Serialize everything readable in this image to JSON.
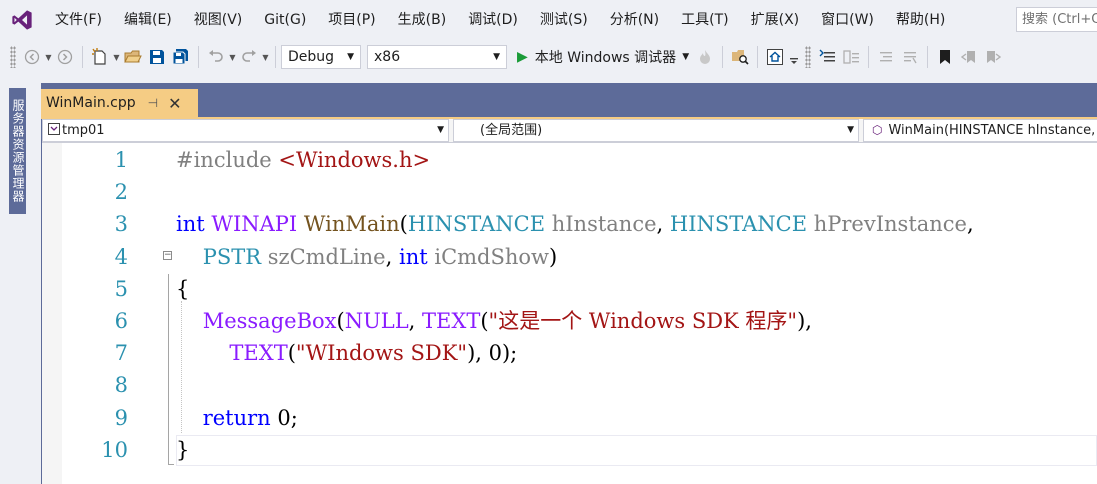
{
  "menu": {
    "items": [
      "文件(F)",
      "编辑(E)",
      "视图(V)",
      "Git(G)",
      "项目(P)",
      "生成(B)",
      "调试(D)",
      "测试(S)",
      "分析(N)",
      "工具(T)",
      "扩展(X)",
      "窗口(W)",
      "帮助(H)"
    ],
    "search_placeholder": "搜索 (Ctrl+Q)"
  },
  "toolbar": {
    "configuration": "Debug",
    "platform": "x86",
    "run_label": "本地 Windows 调试器"
  },
  "side_panel": {
    "label": "服务器资源管理器"
  },
  "document_tab": {
    "title": "WinMain.cpp",
    "pin_icon": "pin-icon",
    "close_icon": "close-icon"
  },
  "nav_bar": {
    "project": "tmp01",
    "scope": "(全局范围)",
    "member": "WinMain(HINSTANCE hInstance, HINSTANCE hPrevInstance, PSTR szCmdLine, int iCmdShow)"
  },
  "editor": {
    "line_numbers": [
      "1",
      "2",
      "3",
      "4",
      "5",
      "6",
      "7",
      "8",
      "9",
      "10"
    ],
    "lines": [
      [
        {
          "t": "#include ",
          "c": "pp"
        },
        {
          "t": "<Windows.h>",
          "c": "str"
        }
      ],
      [],
      [
        {
          "t": "int",
          "c": "kw"
        },
        {
          "t": " ",
          "c": "plain"
        },
        {
          "t": "WINAPI",
          "c": "mac"
        },
        {
          "t": " ",
          "c": "plain"
        },
        {
          "t": "WinMain",
          "c": "fn"
        },
        {
          "t": "(",
          "c": "plain"
        },
        {
          "t": "HINSTANCE",
          "c": "typ"
        },
        {
          "t": " ",
          "c": "plain"
        },
        {
          "t": "hInstance",
          "c": "prm"
        },
        {
          "t": ", ",
          "c": "plain"
        },
        {
          "t": "HINSTANCE",
          "c": "typ"
        },
        {
          "t": " ",
          "c": "plain"
        },
        {
          "t": "hPrevInstance",
          "c": "prm"
        },
        {
          "t": ",",
          "c": "plain"
        }
      ],
      [
        {
          "t": "    ",
          "c": "plain"
        },
        {
          "t": "PSTR",
          "c": "typ"
        },
        {
          "t": " ",
          "c": "plain"
        },
        {
          "t": "szCmdLine",
          "c": "prm"
        },
        {
          "t": ", ",
          "c": "plain"
        },
        {
          "t": "int",
          "c": "kw"
        },
        {
          "t": " ",
          "c": "plain"
        },
        {
          "t": "iCmdShow",
          "c": "prm"
        },
        {
          "t": ")",
          "c": "plain"
        }
      ],
      [
        {
          "t": "{",
          "c": "plain"
        }
      ],
      [
        {
          "t": "    ",
          "c": "plain"
        },
        {
          "t": "MessageBox",
          "c": "mac"
        },
        {
          "t": "(",
          "c": "plain"
        },
        {
          "t": "NULL",
          "c": "mac"
        },
        {
          "t": ", ",
          "c": "plain"
        },
        {
          "t": "TEXT",
          "c": "mac"
        },
        {
          "t": "(",
          "c": "plain"
        },
        {
          "t": "\"这是一个 Windows SDK 程序\"",
          "c": "str"
        },
        {
          "t": "),",
          "c": "plain"
        }
      ],
      [
        {
          "t": "        ",
          "c": "plain"
        },
        {
          "t": "TEXT",
          "c": "mac"
        },
        {
          "t": "(",
          "c": "plain"
        },
        {
          "t": "\"WIndows SDK\"",
          "c": "str"
        },
        {
          "t": "), 0);",
          "c": "plain"
        }
      ],
      [],
      [
        {
          "t": "    ",
          "c": "plain"
        },
        {
          "t": "return",
          "c": "kw"
        },
        {
          "t": " 0;",
          "c": "plain"
        }
      ],
      [
        {
          "t": "}",
          "c": "plain"
        }
      ]
    ]
  },
  "colors": {
    "accent": "#5d6b99",
    "active_tab": "#f5cc84",
    "keyword": "#0000ff",
    "string": "#a31515",
    "macro": "#8a1bff",
    "type": "#2b91af",
    "function": "#74531f",
    "parameter": "#808080",
    "line_number": "#2b91af"
  }
}
